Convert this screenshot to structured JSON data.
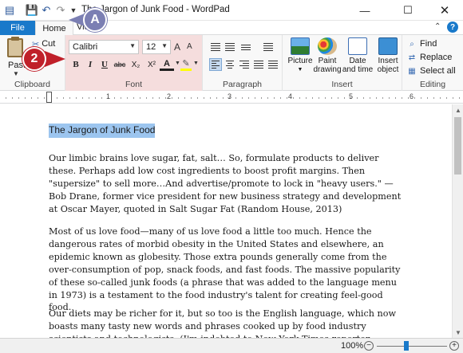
{
  "window": {
    "title": "The Jargon of Junk Food - WordPad",
    "minimize_glyph": "—",
    "maximize_glyph": "☐",
    "close_glyph": "✕"
  },
  "qat": {
    "app_icon": "wordpad-icon",
    "save_icon": "save-icon",
    "undo_icon": "undo-icon",
    "redo_icon": "redo-icon",
    "dropdown_glyph": "▼"
  },
  "tabs": {
    "file": "File",
    "home": "Home",
    "view": "View"
  },
  "ribbon": {
    "clipboard": {
      "label": "Clipboard",
      "paste": "Paste",
      "cut": "Cut"
    },
    "font": {
      "label": "Font",
      "font_name": "Calibri",
      "font_size": "12",
      "grow": "A",
      "shrink": "A",
      "bold": "B",
      "italic": "I",
      "underline": "U",
      "strikethrough": "abc",
      "subscript": "X₂",
      "superscript": "X²",
      "color": "A",
      "highlight": "✎"
    },
    "paragraph": {
      "label": "Paragraph"
    },
    "insert": {
      "label": "Insert",
      "picture": "Picture",
      "paint_drawing": "Paint drawing",
      "date_time": "Date and time",
      "insert_object": "Insert object"
    },
    "editing": {
      "label": "Editing",
      "find": "Find",
      "replace": "Replace",
      "select_all": "Select all"
    }
  },
  "callouts": {
    "a": "A",
    "b": "2"
  },
  "ruler": {
    "numbers": [
      "1",
      "2",
      "3",
      "4",
      "5",
      "6"
    ]
  },
  "document": {
    "title": "The Jargon of Junk Food",
    "paragraphs": [
      "Our limbic brains love sugar, fat, salt… So, formulate products to deliver these. Perhaps add low cost ingredients to boost profit margins. Then \"supersize\" to sell more…And advertise/promote to lock in \"heavy users.\" —Bob Drane, former vice president for new business strategy and development at Oscar Mayer, quoted in Salt Sugar Fat (Random House, 2013)",
      "Most of us love food—many of us love food a little too much. Hence the dangerous rates of morbid obesity in the United States and elsewhere, an epidemic known as globesity. Those extra pounds generally come from the over-consumption of pop, snack foods, and fast foods. The massive popularity of these so-called junk foods (a phrase that was added to the language menu in 1973) is a testament to the food industry's talent for creating feel-good food.",
      "Our diets may be richer for it, but so too is the English language, which now boasts many tasty new words and phrases cooked up by food industry scientists and technologists. (I'm indebted to New York Times reporter Michael Moss, particularly his fascinating new book"
    ]
  },
  "statusbar": {
    "zoom": "100%",
    "zoom_level": 0.5
  },
  "colors": {
    "accent": "#1979ca",
    "font_group_highlight": "#f5dddd",
    "selection": "#9cc5ef",
    "callout_a": "#7b7fb3",
    "callout_b": "#c0202a"
  }
}
